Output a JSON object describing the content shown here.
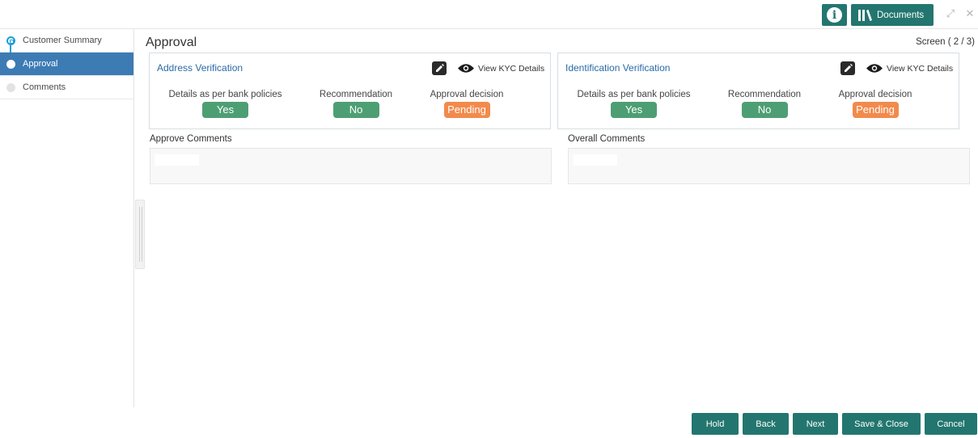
{
  "topbar": {
    "documents_label": "Documents"
  },
  "sidebar": {
    "items": [
      {
        "label": "Customer Summary",
        "state": "completed"
      },
      {
        "label": "Approval",
        "state": "active"
      },
      {
        "label": "Comments",
        "state": "pending"
      }
    ]
  },
  "main": {
    "title": "Approval",
    "screen_indicator": "Screen ( 2 / 3)",
    "cards": [
      {
        "title": "Address Verification",
        "kyc_link": "View KYC Details",
        "fields": [
          {
            "label": "Details as per bank policies",
            "value": "Yes",
            "color": "#4d9f73"
          },
          {
            "label": "Recommendation",
            "value": "No",
            "color": "#4d9f73"
          },
          {
            "label": "Approval decision",
            "value": "Pending",
            "color": "#f28a4c"
          }
        ]
      },
      {
        "title": "Identification Verification",
        "kyc_link": "View KYC Details",
        "fields": [
          {
            "label": "Details as per bank policies",
            "value": "Yes",
            "color": "#4d9f73"
          },
          {
            "label": "Recommendation",
            "value": "No",
            "color": "#4d9f73"
          },
          {
            "label": "Approval decision",
            "value": "Pending",
            "color": "#f28a4c"
          }
        ]
      }
    ],
    "approve_comments_label": "Approve Comments",
    "overall_comments_label": "Overall Comments"
  },
  "footer": {
    "hold": "Hold",
    "back": "Back",
    "next": "Next",
    "save_close": "Save & Close",
    "cancel": "Cancel"
  },
  "colors": {
    "accent": "#23766f",
    "sidebar_active": "#3d7bb4",
    "link": "#2a6aa7"
  }
}
